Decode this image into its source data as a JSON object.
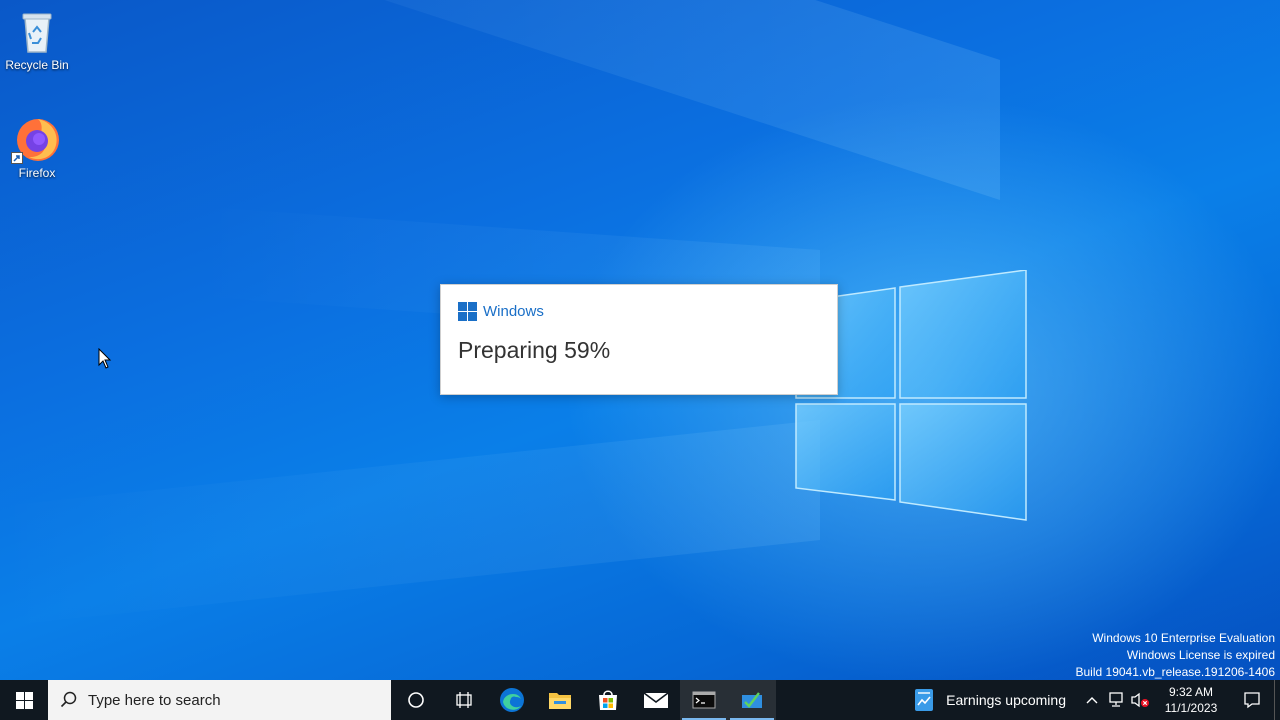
{
  "desktop": {
    "icons": [
      {
        "label": "Recycle Bin",
        "icon": "recycle-bin-icon"
      },
      {
        "label": "Firefox",
        "icon": "firefox-icon"
      }
    ],
    "watermark": {
      "line1": "Windows 10 Enterprise Evaluation",
      "line2": "Windows License is expired",
      "line3": "Build 19041.vb_release.191206-1406"
    }
  },
  "dialog": {
    "brand": "Windows",
    "status": "Preparing 59%",
    "progress_percent": 59
  },
  "taskbar": {
    "search_placeholder": "Type here to search",
    "pinned": [
      {
        "name": "cortana-icon"
      },
      {
        "name": "task-view-icon"
      },
      {
        "name": "edge-icon"
      },
      {
        "name": "file-explorer-icon"
      },
      {
        "name": "microsoft-store-icon"
      },
      {
        "name": "mail-icon"
      },
      {
        "name": "terminal-icon",
        "running": true
      },
      {
        "name": "setup-app-icon",
        "running": true
      }
    ],
    "news": "Earnings upcoming",
    "clock": {
      "time": "9:32 AM",
      "date": "11/1/2023"
    }
  },
  "colors": {
    "accent": "#1a6fc7",
    "taskbar": "#101820",
    "desktop": "#0a6ddf"
  }
}
